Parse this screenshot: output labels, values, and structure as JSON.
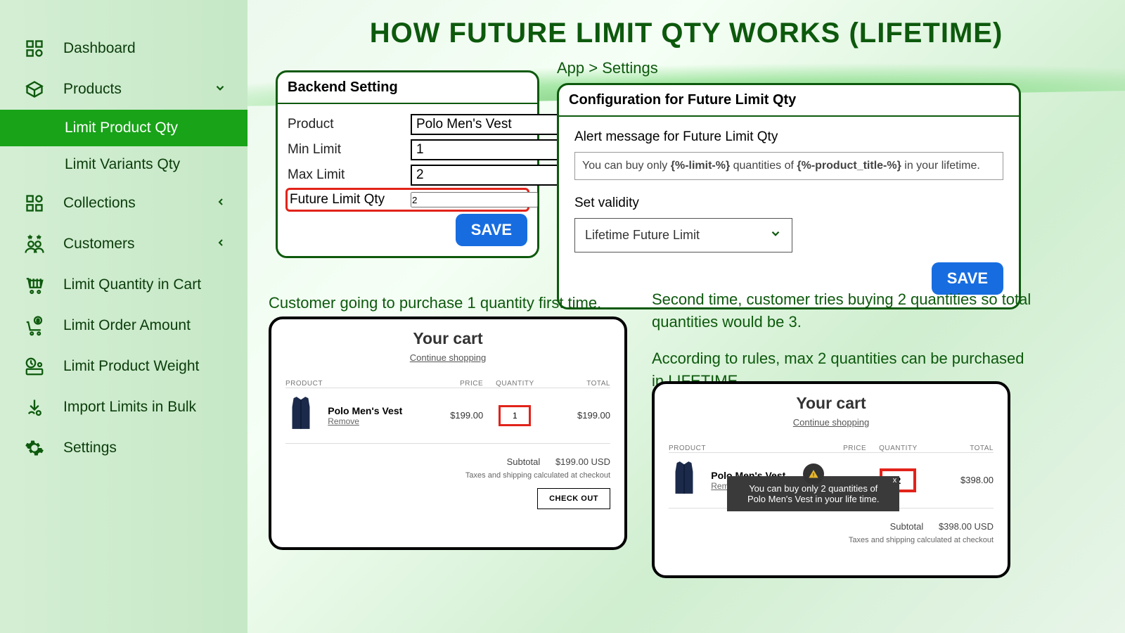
{
  "sidebar": {
    "dashboard": "Dashboard",
    "products": "Products",
    "limit_product_qty": "Limit Product Qty",
    "limit_variants_qty": "Limit Variants Qty",
    "collections": "Collections",
    "customers": "Customers",
    "limit_qty_cart": "Limit Quantity in Cart",
    "limit_order_amount": "Limit Order Amount",
    "limit_product_weight": "Limit Product Weight",
    "import_bulk": "Import Limits in Bulk",
    "settings": "Settings"
  },
  "page_title": "HOW FUTURE LIMIT QTY WORKS (LIFETIME)",
  "backend": {
    "title": "Backend Setting",
    "product_label": "Product",
    "product_value": "Polo Men's Vest",
    "min_label": "Min Limit",
    "min_value": "1",
    "max_label": "Max Limit",
    "max_value": "2",
    "future_label": "Future Limit Qty",
    "future_value": "2",
    "save": "SAVE"
  },
  "breadcrumb": "App > Settings",
  "config": {
    "title": "Configuration for Future Limit Qty",
    "alert_label": "Alert message for Future Limit Qty",
    "alert_text": "You can buy only {%-limit-%} quantities of {%-product_title-%} in your lifetime.",
    "validity_label": "Set validity",
    "validity_value": "Lifetime Future Limit",
    "save": "SAVE"
  },
  "caption1": "Customer going to purchase 1 quantity first time.",
  "caption2a": "Second time, customer tries buying 2 quantities so total quantities would be 3.",
  "caption2b": "According to rules, max 2 quantities can be purchased in LIFETIME.",
  "cart": {
    "title": "Your cart",
    "continue": "Continue shopping",
    "th_product": "PRODUCT",
    "th_price": "PRICE",
    "th_qty": "QUANTITY",
    "th_total": "TOTAL",
    "prod_name": "Polo Men's Vest",
    "remove": "Remove",
    "price": "$199.00",
    "qty1": "1",
    "qty2": "2",
    "total1": "$199.00",
    "total2": "$398.00",
    "subtotal_lbl": "Subtotal",
    "subtotal1": "$199.00 USD",
    "subtotal2": "$398.00 USD",
    "taxline": "Taxes and shipping calculated at checkout",
    "checkout": "CHECK OUT"
  },
  "toast": {
    "line1": "You can buy only 2 quantities of",
    "line2": "Polo Men's Vest in your life time.",
    "close": "x"
  }
}
